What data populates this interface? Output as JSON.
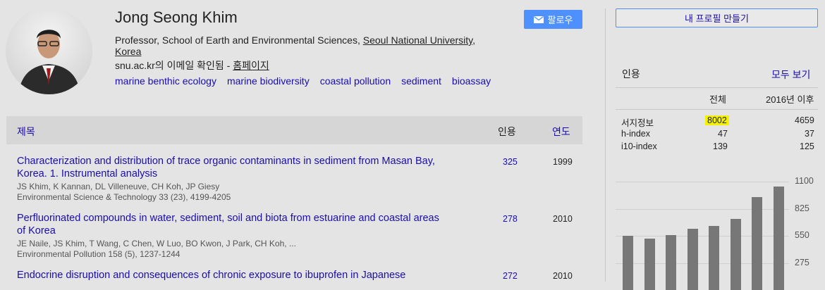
{
  "profile": {
    "name": "Jong Seong Khim",
    "affiliation_prefix": "Professor, School of Earth and Environmental Sciences, ",
    "affiliation_link": "Seoul National University,",
    "affiliation_line2": "Korea",
    "email_text": "snu.ac.kr의 이메일 확인됨 - ",
    "homepage_label": "홈페이지",
    "interests": [
      "marine benthic ecology",
      "marine biodiversity",
      "coastal pollution",
      "sediment",
      "bioassay"
    ]
  },
  "follow_label": "팔로우",
  "table": {
    "header_title": "제목",
    "header_cited": "인용",
    "header_year": "연도",
    "papers": [
      {
        "title_line1": "Characterization and distribution of trace organic contaminants in sediment from Masan Bay,",
        "title_line2": "Korea. 1. Instrumental analysis",
        "authors": "JS Khim, K Kannan, DL Villeneuve, CH Koh, JP Giesy",
        "venue": "Environmental Science & Technology 33 (23), 4199-4205",
        "cited": "325",
        "year": "1999"
      },
      {
        "title_line1": "Perfluorinated compounds in water, sediment, soil and biota from estuarine and coastal areas",
        "title_line2": "of Korea",
        "authors": "JE Naile, JS Khim, T Wang, C Chen, W Luo, BO Kwon, J Park, CH Koh, ...",
        "venue": "Environmental Pollution 158 (5), 1237-1244",
        "cited": "278",
        "year": "2010"
      },
      {
        "title_line1": "Endocrine disruption and consequences of chronic exposure to ibuprofen in Japanese",
        "cited": "272",
        "year": "2010"
      }
    ]
  },
  "sidebar": {
    "make_profile_label": "내 프로필 만들기",
    "cited_by_label": "인용",
    "view_all_label": "모두 보기",
    "col_all": "전체",
    "col_since": "2016년 이후",
    "rows": [
      {
        "label": "서지정보",
        "all": "8002",
        "since": "4659"
      },
      {
        "label": "h-index",
        "all": "47",
        "since": "37"
      },
      {
        "label": "i10-index",
        "all": "139",
        "since": "125"
      }
    ],
    "highlight_color": "#f5f200"
  },
  "chart_data": {
    "type": "bar",
    "yticks": [
      "1100",
      "825",
      "550",
      "275"
    ],
    "ylim": [
      0,
      1100
    ],
    "values": [
      550,
      525,
      555,
      620,
      650,
      725,
      940,
      1050
    ],
    "bar_color": "#777777"
  }
}
